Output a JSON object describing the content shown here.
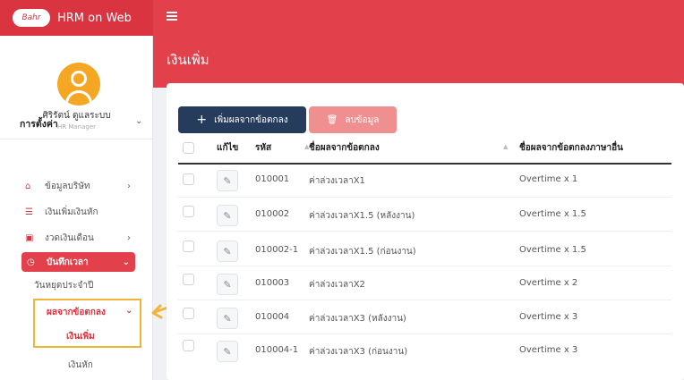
{
  "app": {
    "brand_logo": "Bahr",
    "brand_name": "HRM on Web"
  },
  "user": {
    "name": "ศิริรัตน์ ดูแลระบบ",
    "role": "HR Manager"
  },
  "sidebar": {
    "section_title": "การตั้งค่า",
    "items": [
      {
        "label": "ข้อมูลบริษัท",
        "icon": "home-icon"
      },
      {
        "label": "เงินเพิ่มเงินหัก",
        "icon": "list-icon"
      },
      {
        "label": "งวดเงินเดือน",
        "icon": "money-icon"
      },
      {
        "label": "บันทึกเวลา",
        "icon": "clock-icon"
      }
    ],
    "sub_items": [
      "วันหยุดประจำปี",
      "ผลจากข้อตกลง",
      "เงินเพิ่ม",
      "เงินหัก"
    ]
  },
  "page": {
    "title": "เงินเพิ่ม"
  },
  "toolbar": {
    "add_label": "เพิ่มผลจากข้อตกลง",
    "delete_label": "ลบข้อมูล"
  },
  "table": {
    "columns": [
      "แก้ไข",
      "รหัส",
      "ชื่อผลจากข้อตกลง",
      "ชื่อผลจากข้อตกลงภาษาอื่น"
    ],
    "rows": [
      {
        "code": "010001",
        "name": "ค่าล่วงเวลาX1",
        "name_other": "Overtime x 1"
      },
      {
        "code": "010002",
        "name": "ค่าล่วงเวลาX1.5 (หลังงาน)",
        "name_other": "Overtime x 1.5"
      },
      {
        "code": "010002-1",
        "name": "ค่าล่วงเวลาX1.5 (ก่อนงาน)",
        "name_other": "Overtime x 1.5"
      },
      {
        "code": "010003",
        "name": "ค่าล่วงเวลาX2",
        "name_other": "Overtime x 2"
      },
      {
        "code": "010004",
        "name": "ค่าล่วงเวลาX3 (หลังงาน)",
        "name_other": "Overtime x 3"
      },
      {
        "code": "010004-1",
        "name": "ค่าล่วงเวลาX3 (ก่อนงาน)",
        "name_other": "Overtime x 3"
      }
    ]
  },
  "colors": {
    "primary": "#e2404b",
    "navy": "#253c5c",
    "highlight": "#f0b43a"
  }
}
